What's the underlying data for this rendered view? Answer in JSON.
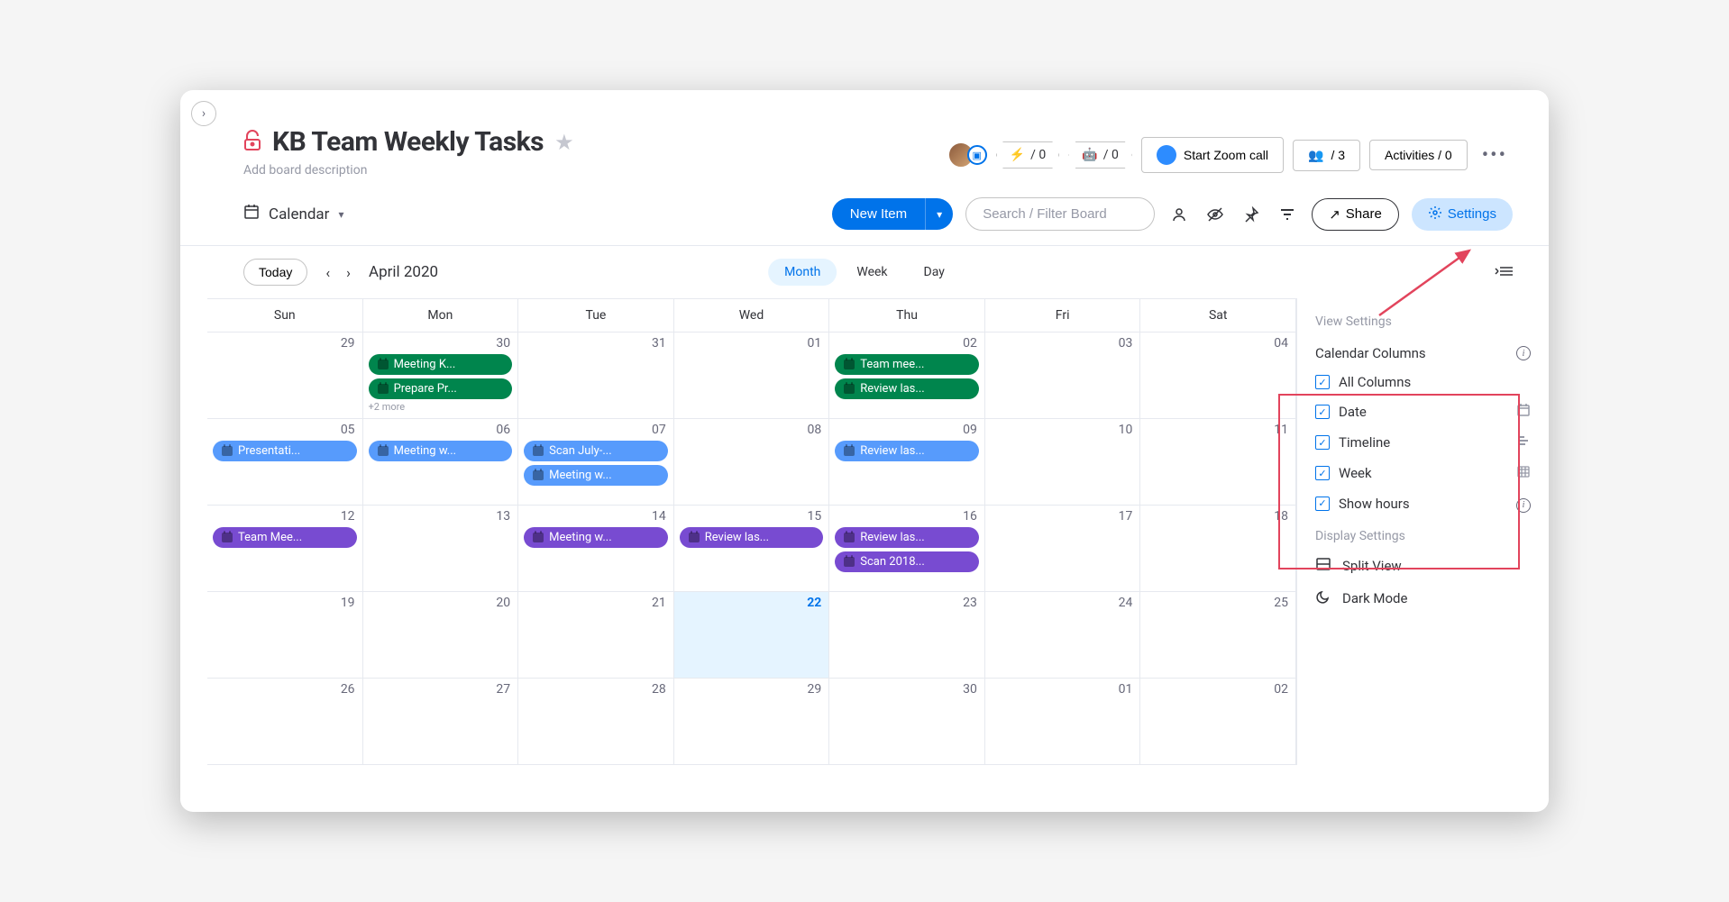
{
  "header": {
    "title": "KB Team Weekly Tasks",
    "description_placeholder": "Add board description"
  },
  "top_actions": {
    "integrations_count": "/ 0",
    "automations_count": "/ 0",
    "zoom_label": "Start Zoom call",
    "members_count": "/ 3",
    "activities_label": "Activities / 0"
  },
  "toolbar": {
    "view_name": "Calendar",
    "new_item_label": "New Item",
    "search_placeholder": "Search / Filter Board",
    "share_label": "Share",
    "settings_label": "Settings"
  },
  "calendar": {
    "today_label": "Today",
    "month_label": "April 2020",
    "modes": {
      "month": "Month",
      "week": "Week",
      "day": "Day"
    },
    "days": [
      "Sun",
      "Mon",
      "Tue",
      "Wed",
      "Thu",
      "Fri",
      "Sat"
    ],
    "cells": [
      {
        "num": "29"
      },
      {
        "num": "30",
        "events": [
          {
            "c": "green",
            "t": "Meeting K..."
          },
          {
            "c": "green",
            "t": "Prepare Pr..."
          }
        ],
        "more": "+2 more"
      },
      {
        "num": "31"
      },
      {
        "num": "01"
      },
      {
        "num": "02",
        "events": [
          {
            "c": "green",
            "t": "Team mee..."
          },
          {
            "c": "green",
            "t": "Review las..."
          }
        ]
      },
      {
        "num": "03"
      },
      {
        "num": "04"
      },
      {
        "num": "05",
        "events": [
          {
            "c": "blue",
            "t": "Presentati..."
          }
        ]
      },
      {
        "num": "06",
        "events": [
          {
            "c": "blue",
            "t": "Meeting w..."
          }
        ]
      },
      {
        "num": "07",
        "events": [
          {
            "c": "blue",
            "t": "Scan July-..."
          },
          {
            "c": "blue",
            "t": "Meeting w..."
          }
        ]
      },
      {
        "num": "08"
      },
      {
        "num": "09",
        "events": [
          {
            "c": "blue",
            "t": "Review las..."
          }
        ]
      },
      {
        "num": "10"
      },
      {
        "num": "11"
      },
      {
        "num": "12",
        "events": [
          {
            "c": "purple",
            "t": "Team Mee..."
          }
        ]
      },
      {
        "num": "13"
      },
      {
        "num": "14",
        "events": [
          {
            "c": "purple",
            "t": "Meeting w..."
          }
        ]
      },
      {
        "num": "15",
        "events": [
          {
            "c": "purple",
            "t": "Review las..."
          }
        ]
      },
      {
        "num": "16",
        "events": [
          {
            "c": "purple",
            "t": "Review las..."
          },
          {
            "c": "purple",
            "t": "Scan 2018..."
          }
        ]
      },
      {
        "num": "17"
      },
      {
        "num": "18"
      },
      {
        "num": "19"
      },
      {
        "num": "20"
      },
      {
        "num": "21"
      },
      {
        "num": "22",
        "today": true
      },
      {
        "num": "23"
      },
      {
        "num": "24"
      },
      {
        "num": "25"
      },
      {
        "num": "26"
      },
      {
        "num": "27"
      },
      {
        "num": "28"
      },
      {
        "num": "29"
      },
      {
        "num": "30"
      },
      {
        "num": "01"
      },
      {
        "num": "02"
      }
    ]
  },
  "settings_panel": {
    "title": "View Settings",
    "columns_header": "Calendar Columns",
    "columns": [
      {
        "label": "All Columns",
        "checked": true,
        "icon": ""
      },
      {
        "label": "Date",
        "checked": true,
        "icon": "date"
      },
      {
        "label": "Timeline",
        "checked": true,
        "icon": "timeline"
      },
      {
        "label": "Week",
        "checked": true,
        "icon": "week"
      },
      {
        "label": "Show hours",
        "checked": true,
        "icon": "info"
      }
    ],
    "display_header": "Display Settings",
    "display": [
      {
        "label": "Split View",
        "icon": "split"
      },
      {
        "label": "Dark Mode",
        "icon": "moon"
      }
    ]
  }
}
